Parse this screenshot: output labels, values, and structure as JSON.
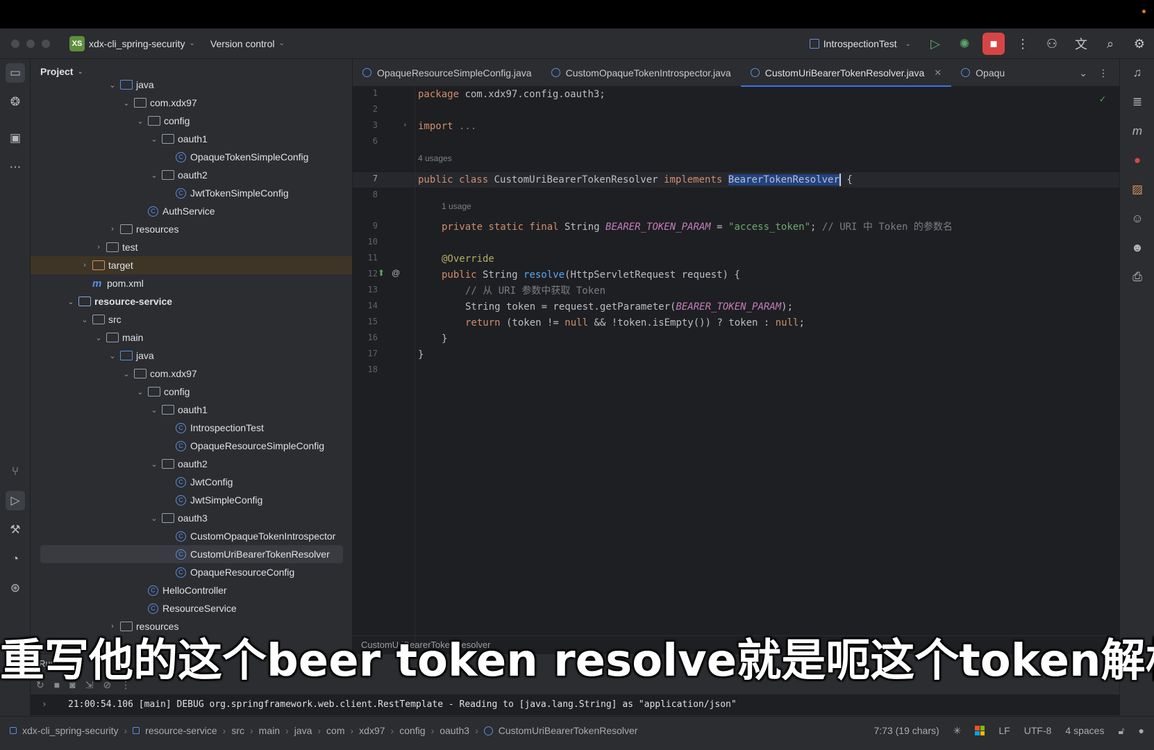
{
  "titlebar": {
    "project_badge": "XS",
    "project_name": "xdx-cli_spring-security",
    "version_control": "Version control",
    "run_config": "IntrospectionTest"
  },
  "project_panel": {
    "title": "Project",
    "nodes": [
      {
        "label": "java",
        "indent": 5,
        "type": "folder-blue",
        "arrow": "v"
      },
      {
        "label": "com.xdx97",
        "indent": 6,
        "type": "folder",
        "arrow": "v"
      },
      {
        "label": "config",
        "indent": 7,
        "type": "folder",
        "arrow": "v"
      },
      {
        "label": "oauth1",
        "indent": 8,
        "type": "folder",
        "arrow": "v"
      },
      {
        "label": "OpaqueTokenSimpleConfig",
        "indent": 9,
        "type": "class",
        "arrow": ""
      },
      {
        "label": "oauth2",
        "indent": 8,
        "type": "folder",
        "arrow": "v"
      },
      {
        "label": "JwtTokenSimpleConfig",
        "indent": 9,
        "type": "class",
        "arrow": ""
      },
      {
        "label": "AuthService",
        "indent": 7,
        "type": "class",
        "arrow": ""
      },
      {
        "label": "resources",
        "indent": 5,
        "type": "folder",
        "arrow": ">"
      },
      {
        "label": "test",
        "indent": 4,
        "type": "folder",
        "arrow": ">"
      },
      {
        "label": "target",
        "indent": 3,
        "type": "folder-orange",
        "arrow": ">"
      },
      {
        "label": "pom.xml",
        "indent": 3,
        "type": "maven",
        "arrow": ""
      },
      {
        "label": "resource-service",
        "indent": 2,
        "type": "module",
        "arrow": "v"
      },
      {
        "label": "src",
        "indent": 3,
        "type": "folder",
        "arrow": "v"
      },
      {
        "label": "main",
        "indent": 4,
        "type": "folder",
        "arrow": "v"
      },
      {
        "label": "java",
        "indent": 5,
        "type": "folder-blue",
        "arrow": "v"
      },
      {
        "label": "com.xdx97",
        "indent": 6,
        "type": "folder",
        "arrow": "v"
      },
      {
        "label": "config",
        "indent": 7,
        "type": "folder",
        "arrow": "v"
      },
      {
        "label": "oauth1",
        "indent": 8,
        "type": "folder",
        "arrow": "v"
      },
      {
        "label": "IntrospectionTest",
        "indent": 9,
        "type": "class",
        "arrow": ""
      },
      {
        "label": "OpaqueResourceSimpleConfig",
        "indent": 9,
        "type": "class",
        "arrow": ""
      },
      {
        "label": "oauth2",
        "indent": 8,
        "type": "folder",
        "arrow": "v"
      },
      {
        "label": "JwtConfig",
        "indent": 9,
        "type": "class",
        "arrow": ""
      },
      {
        "label": "JwtSimpleConfig",
        "indent": 9,
        "type": "class",
        "arrow": ""
      },
      {
        "label": "oauth3",
        "indent": 8,
        "type": "folder",
        "arrow": "v"
      },
      {
        "label": "CustomOpaqueTokenIntrospector",
        "indent": 9,
        "type": "class",
        "arrow": ""
      },
      {
        "label": "CustomUriBearerTokenResolver",
        "indent": 9,
        "type": "class",
        "arrow": ""
      },
      {
        "label": "OpaqueResourceConfig",
        "indent": 9,
        "type": "class",
        "arrow": ""
      },
      {
        "label": "HelloController",
        "indent": 7,
        "type": "class",
        "arrow": ""
      },
      {
        "label": "ResourceService",
        "indent": 7,
        "type": "class",
        "arrow": ""
      },
      {
        "label": "resources",
        "indent": 5,
        "type": "folder",
        "arrow": ">"
      }
    ]
  },
  "tabs": [
    {
      "label": "OpaqueResourceSimpleConfig.java"
    },
    {
      "label": "CustomOpaqueTokenIntrospector.java"
    },
    {
      "label": "CustomUriBearerTokenResolver.java"
    },
    {
      "label": "Opaqu"
    }
  ],
  "editor": {
    "line_numbers": [
      "1",
      "2",
      "3",
      "6",
      "7",
      "8",
      "9",
      "10",
      "11",
      "12",
      "13",
      "14",
      "15",
      "16",
      "17",
      "18"
    ],
    "usage_hint_class": "4 usages",
    "usage_hint_field": "1 usage",
    "line1": {
      "kw": "package",
      "rest": " com.xdx97.config.oauth3;"
    },
    "line3": {
      "kw": "import",
      "rest": " ..."
    },
    "line7": {
      "kw1": "public class",
      "name": " CustomUriBearerTokenResolver ",
      "kw2": "implements",
      "sp": " ",
      "sel": "BearerTokenResolver",
      "rest": " {"
    },
    "line9": {
      "kw": "private static final",
      "type": " String ",
      "const": "BEARER_TOKEN_PARAM",
      "eq": " = ",
      "str": "\"access_token\"",
      "semi": "; ",
      "cmt": "// URI 中 Token 的参数名"
    },
    "line11": {
      "ann": "@Override"
    },
    "line12": {
      "kw": "public",
      "type": " String ",
      "fn": "resolve",
      "rest": "(HttpServletRequest request) {"
    },
    "line13": {
      "cmt": "// 从 URI 参数中获取 Token"
    },
    "line14": {
      "a": "String token = request.getParameter(",
      "const": "BEARER_TOKEN_PARAM",
      "b": ");"
    },
    "line15": {
      "kw": "return",
      "a": " (token != ",
      "null1": "null",
      "b": " && !token.isEmpty()) ? token : ",
      "null2": "null",
      "c": ";"
    },
    "line16": {
      "text": "}"
    },
    "line17": {
      "text": "}"
    },
    "breadcrumb": "CustomUriBearerTokenResolver"
  },
  "run_panel": {
    "tab_run": "Run",
    "log": "21:00:54.106 [main] DEBUG org.springframework.web.client.RestTemplate - Reading to [java.lang.String] as \"application/json\""
  },
  "statusbar": {
    "crumbs": [
      "xdx-cli_spring-security",
      "resource-service",
      "src",
      "main",
      "java",
      "com",
      "xdx97",
      "config",
      "oauth3",
      "CustomUriBearerTokenResolver"
    ],
    "position": "7:73 (19 chars)",
    "line_sep": "LF",
    "encoding": "UTF-8",
    "indent": "4 spaces"
  },
  "subtitle": "重写他的这个beer token resolve就是呃这个token解析的方"
}
